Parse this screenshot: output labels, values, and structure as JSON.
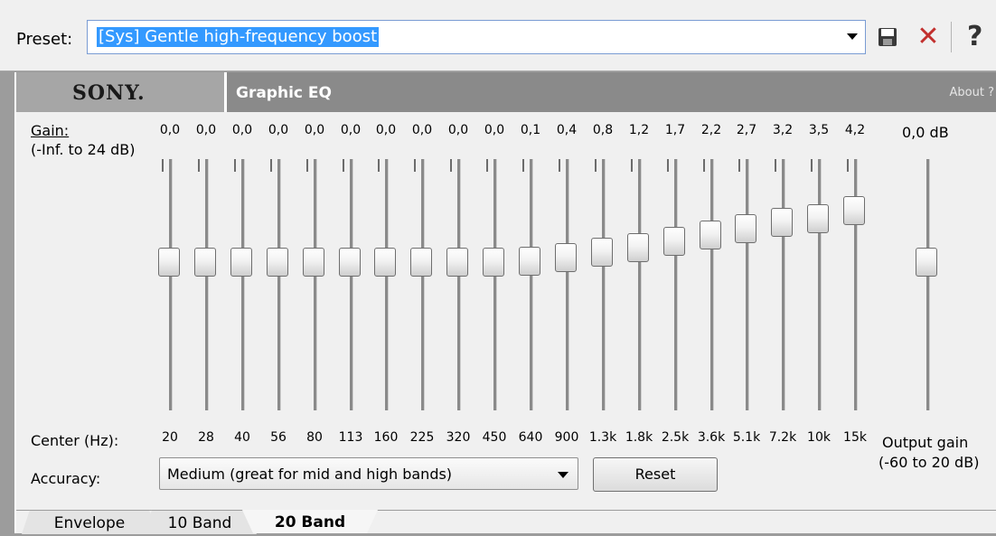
{
  "preset": {
    "label": "Preset:",
    "value": "[Sys] Gentle high-frequency boost",
    "icons": [
      "save-icon",
      "delete-icon",
      "help-icon"
    ],
    "delete_glyph": "✕",
    "help_glyph": "?"
  },
  "header": {
    "logo": "SONY.",
    "title": "Graphic EQ",
    "about": "About ?"
  },
  "gain": {
    "label": "Gain:",
    "range": "(-Inf. to 24 dB)"
  },
  "bands": [
    {
      "value": "0,0",
      "center": "20",
      "gain_db": 0.0
    },
    {
      "value": "0,0",
      "center": "28",
      "gain_db": 0.0
    },
    {
      "value": "0,0",
      "center": "40",
      "gain_db": 0.0
    },
    {
      "value": "0,0",
      "center": "56",
      "gain_db": 0.0
    },
    {
      "value": "0,0",
      "center": "80",
      "gain_db": 0.0
    },
    {
      "value": "0,0",
      "center": "113",
      "gain_db": 0.0
    },
    {
      "value": "0,0",
      "center": "160",
      "gain_db": 0.0
    },
    {
      "value": "0,0",
      "center": "225",
      "gain_db": 0.0
    },
    {
      "value": "0,0",
      "center": "320",
      "gain_db": 0.0
    },
    {
      "value": "0,0",
      "center": "450",
      "gain_db": 0.0
    },
    {
      "value": "0,1",
      "center": "640",
      "gain_db": 0.1
    },
    {
      "value": "0,4",
      "center": "900",
      "gain_db": 0.4
    },
    {
      "value": "0,8",
      "center": "1.3k",
      "gain_db": 0.8
    },
    {
      "value": "1,2",
      "center": "1.8k",
      "gain_db": 1.2
    },
    {
      "value": "1,7",
      "center": "2.5k",
      "gain_db": 1.7
    },
    {
      "value": "2,2",
      "center": "3.6k",
      "gain_db": 2.2
    },
    {
      "value": "2,7",
      "center": "5.1k",
      "gain_db": 2.7
    },
    {
      "value": "3,2",
      "center": "7.2k",
      "gain_db": 3.2
    },
    {
      "value": "3,5",
      "center": "10k",
      "gain_db": 3.5
    },
    {
      "value": "4,2",
      "center": "15k",
      "gain_db": 4.2
    }
  ],
  "output": {
    "value": "0,0 dB",
    "gain_db": 0.0,
    "label": "Output gain",
    "range": "(-60 to 20 dB)"
  },
  "center_label": "Center (Hz):",
  "accuracy": {
    "label": "Accuracy:",
    "value": "Medium (great for mid and high bands)"
  },
  "reset_label": "Reset",
  "tabs": [
    {
      "label": "Envelope",
      "active": false
    },
    {
      "label": "10 Band",
      "active": false
    },
    {
      "label": "20 Band",
      "active": true
    }
  ],
  "colors": {
    "selection": "#3399ff",
    "delete": "#c2302e"
  }
}
